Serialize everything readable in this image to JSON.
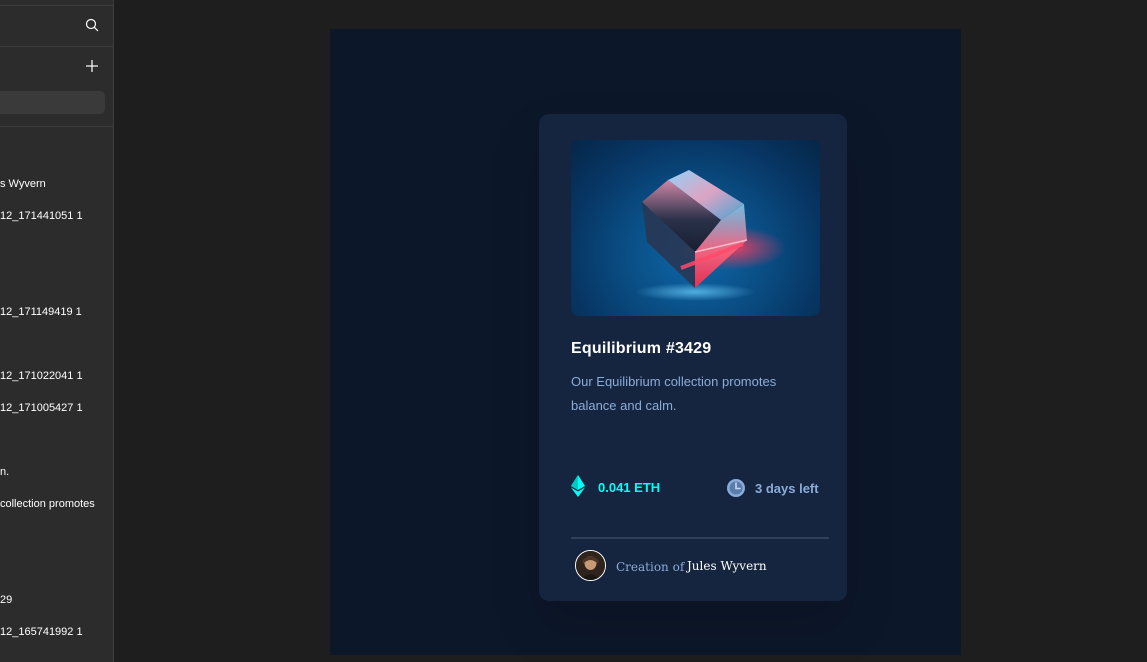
{
  "layers_panel": {
    "items": [
      {
        "label": "s Wyvern"
      },
      {
        "label": "12_171441051 1"
      },
      {
        "label": "12_171149419 1"
      },
      {
        "label": "12_171022041 1"
      },
      {
        "label": "12_171005427 1"
      },
      {
        "label": "n."
      },
      {
        "label": "collection promotes"
      },
      {
        "label": "29"
      },
      {
        "label": "12_165741992 1"
      }
    ]
  },
  "card": {
    "title": "Equilibrium #3429",
    "description": "Our Equilibrium collection promotes balance and calm.",
    "price": "0.041 ETH",
    "time_left": "3 days left",
    "creation_label": "Creation of",
    "creator_name": "Jules Wyvern"
  },
  "colors": {
    "frame_bg": "#0c172a",
    "card_bg": "#15253f",
    "accent_cyan": "#00fff8",
    "soft_blue": "#8bacd9",
    "panel_bg": "#2c2c2c",
    "editor_bg": "#1e1e1e"
  },
  "icons": {
    "search": "search-icon",
    "add": "plus-icon",
    "price": "ethereum-icon",
    "time": "clock-icon"
  }
}
